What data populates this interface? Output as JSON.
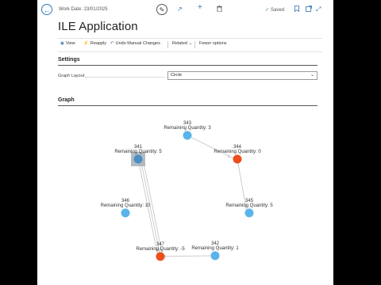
{
  "topbar": {
    "back_icon": "back-arrow-icon",
    "work_date": "Work Date: 23/01/2025",
    "edit_icon": "pencil-icon",
    "share_icon": "share-icon",
    "new_icon": "plus-icon",
    "delete_icon": "trash-icon",
    "saved_label": "Saved",
    "bookmark_icon": "bookmark-icon",
    "open_new_icon": "open-in-new-window-icon",
    "expand_icon": "expand-icon"
  },
  "title": "ILE Application",
  "actions": {
    "view": "View",
    "reapply": "Reapply",
    "undo": "Undo Manual Changes",
    "related": "Related",
    "fewer": "Fewer options"
  },
  "settings": {
    "heading": "Settings",
    "graph_layout_label": "Graph Layout",
    "graph_layout_value": "Circle"
  },
  "graph": {
    "heading": "Graph",
    "nodes": [
      {
        "id": "343",
        "label": "Remaining Quantity: 3",
        "color": "#5ab4ea"
      },
      {
        "id": "344",
        "label": "Remaining Quantity: 0",
        "color": "#ee4e1d"
      },
      {
        "id": "345",
        "label": "Remaining Quantity: 5",
        "color": "#5ab4ea"
      },
      {
        "id": "342",
        "label": "Remaining Quantity: 1",
        "color": "#5ab4ea"
      },
      {
        "id": "347",
        "label": "Remaining Quantity: -5",
        "color": "#ee4e1d"
      },
      {
        "id": "346",
        "label": "Remaining Quantity: 10",
        "color": "#5ab4ea"
      },
      {
        "id": "341",
        "label": "Remaining Quantity: 5",
        "color": "#4a8fc4",
        "selected": true
      }
    ],
    "edges": [
      [
        "343",
        "344"
      ],
      [
        "344",
        "345"
      ],
      [
        "342",
        "347"
      ],
      [
        "341",
        "347"
      ],
      [
        "341",
        "347"
      ],
      [
        "341",
        "347"
      ]
    ]
  }
}
